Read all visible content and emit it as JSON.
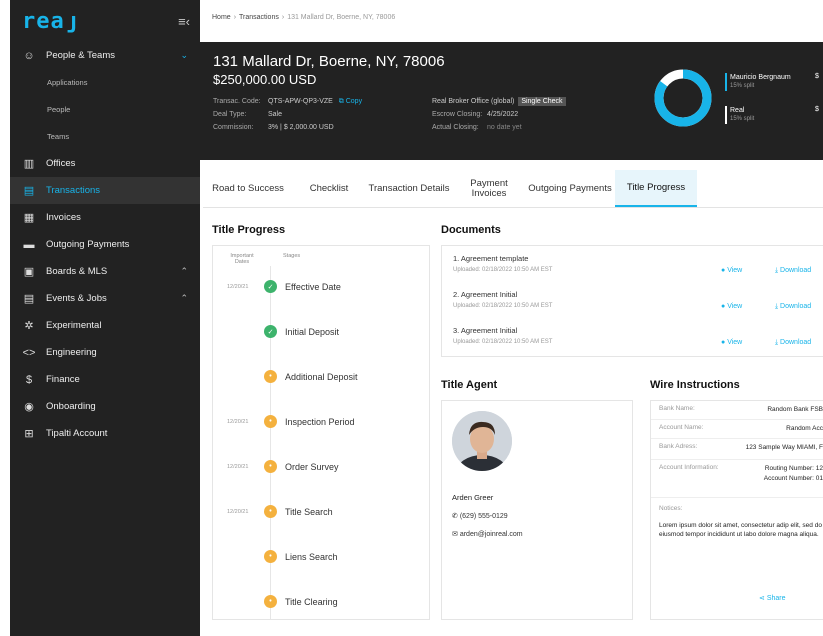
{
  "sidebar": {
    "logo": "reaյ",
    "items": [
      {
        "icon": "people-icon",
        "glyph": "☺",
        "label": "People & Teams",
        "chev": "⌄"
      },
      {
        "icon": "offices-icon",
        "glyph": "▥",
        "label": "Offices"
      },
      {
        "icon": "transactions-icon",
        "glyph": "▤",
        "label": "Transactions"
      },
      {
        "icon": "invoices-icon",
        "glyph": "▦",
        "label": "Invoices"
      },
      {
        "icon": "outgoing-payments-icon",
        "glyph": "▬",
        "label": "Outgoing Payments"
      },
      {
        "icon": "boards-icon",
        "glyph": "▣",
        "label": "Boards & MLS",
        "chev": "⌃"
      },
      {
        "icon": "events-icon",
        "glyph": "▤",
        "label": "Events & Jobs",
        "chev": "⌃"
      },
      {
        "icon": "experimental-icon",
        "glyph": "✲",
        "label": "Experimental"
      },
      {
        "icon": "engineering-icon",
        "glyph": "<>",
        "label": "Engineering"
      },
      {
        "icon": "finance-icon",
        "glyph": "$",
        "label": "Finance"
      },
      {
        "icon": "onboarding-icon",
        "glyph": "◉",
        "label": "Onboarding"
      },
      {
        "icon": "account-icon",
        "glyph": "⊞",
        "label": "Tipalti Account"
      }
    ],
    "subitems": [
      "Applications",
      "People",
      "Teams"
    ]
  },
  "breadcrumb": {
    "home": "Home",
    "section": "Transactions",
    "current": "131 Mallard Dr, Boerne, NY, 78006"
  },
  "header": {
    "address": "131 Mallard Dr, Boerne, NY, 78006",
    "price": "$250,000.00 USD",
    "code_label": "Transac. Code:",
    "code_value": "QTS-APW-QP3-VZE",
    "copy_label": "Copy",
    "deal_type_label": "Deal Type:",
    "deal_type_value": "Sale",
    "commission_label": "Commission:",
    "commission_value": "3% | $ 2,000.00 USD",
    "office_label": "Real Broker Office (global)",
    "office_badge": "Single Check",
    "escrow_label": "Escrow Closing:",
    "escrow_value": "4/25/2022",
    "actual_label": "Actual Closing:",
    "actual_value": "no date yet",
    "agents": [
      {
        "name": "Mauricio Bergnaum",
        "split": "15% split",
        "amount": "$"
      },
      {
        "name": "Real",
        "split": "15% split",
        "amount": "$"
      }
    ],
    "donut_share_fraction": 0.85
  },
  "tabs": [
    {
      "label": "Road to Success"
    },
    {
      "label": "Checklist"
    },
    {
      "label": "Transaction Details"
    },
    {
      "label": "Payment Invoices"
    },
    {
      "label": "Outgoing Payments"
    },
    {
      "label": "Title Progress",
      "active": true
    }
  ],
  "title_progress": {
    "heading": "Title Progress",
    "col_dates": "Important Dates",
    "col_stages": "Stages",
    "steps": [
      {
        "label": "Effective Date",
        "date": "12/20/21",
        "status": "green",
        "mark": "✓"
      },
      {
        "label": "Initial Deposit",
        "date": "",
        "status": "green",
        "mark": "✓"
      },
      {
        "label": "Additional Deposit",
        "date": "",
        "status": "orange",
        "mark": "•"
      },
      {
        "label": "Inspection Period",
        "date": "12/20/21",
        "status": "orange",
        "mark": "•"
      },
      {
        "label": "Order Survey",
        "date": "12/20/21",
        "status": "orange",
        "mark": "•"
      },
      {
        "label": "Title Search",
        "date": "12/20/21",
        "status": "orange",
        "mark": "•"
      },
      {
        "label": "Liens Search",
        "date": "",
        "status": "orange",
        "mark": "•"
      },
      {
        "label": "Title Clearing",
        "date": "",
        "status": "orange",
        "mark": "•"
      }
    ]
  },
  "documents": {
    "heading": "Documents",
    "view_label": "View",
    "download_label": "Download",
    "items": [
      {
        "name": "1. Agreement template",
        "uploaded": "Uploaded: 02/18/2022 10:50 AM EST"
      },
      {
        "name": "2. Agreement Initial",
        "uploaded": "Uploaded: 02/18/2022 10:50 AM EST"
      },
      {
        "name": "3. Agreement Initial",
        "uploaded": "Uploaded: 02/18/2022 10:50 AM EST"
      }
    ]
  },
  "title_agent": {
    "heading": "Title Agent",
    "name": "Arden Greer",
    "phone": "(629) 555-0129",
    "email": "arden@joinreal.com"
  },
  "wire": {
    "heading": "Wire Instructions",
    "bank_name_label": "Bank Name:",
    "bank_name_value": "Random Bank FSB",
    "account_name_label": "Account Name:",
    "account_name_value": "Random Acc",
    "bank_address_label": "Bank Adress:",
    "bank_address_value": "123 Sample Way MIAMI, F",
    "account_info_label": "Account Information:",
    "routing_value": "Routing Number: 12",
    "account_number_value": "Account Number: 01",
    "notices_label": "Notices:",
    "notices_value": "Lorem ipsum dolor sit amet, consectetur adip elit, sed do eiusmod tempor incididunt ut labo dolore magna aliqua.",
    "share_label": "Share"
  },
  "colors": {
    "accent": "#18b4e9",
    "green": "#3db36c",
    "orange": "#f4b13e",
    "dark": "#222222"
  }
}
